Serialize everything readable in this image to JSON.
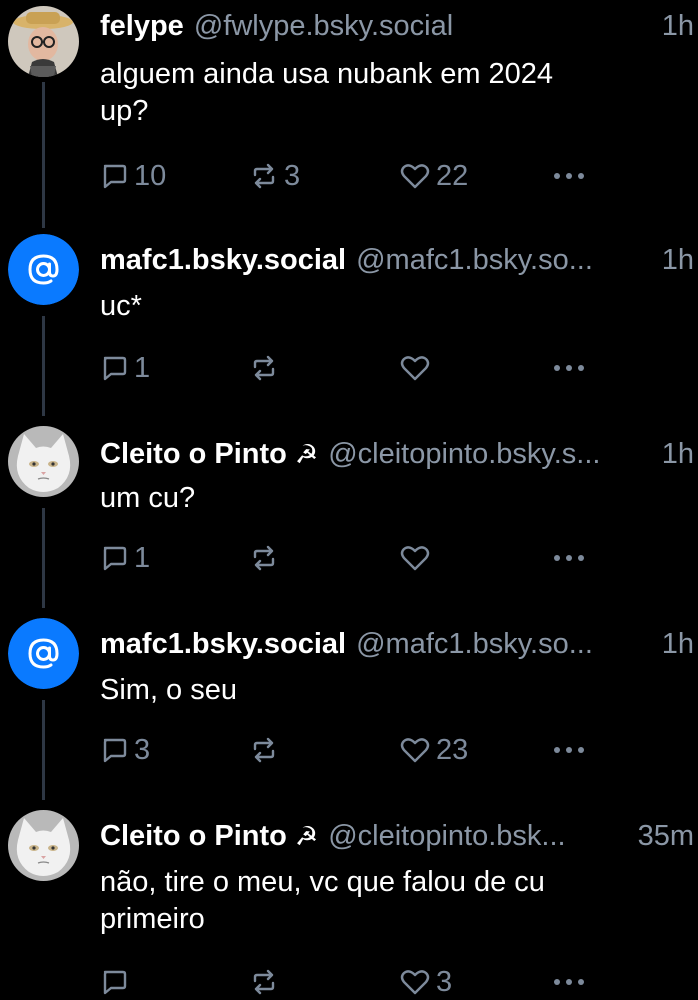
{
  "posts": [
    {
      "display_name": "felype",
      "handle": "@fwlype.bsky.social",
      "time": "1h",
      "text_lines": [
        "alguem ainda usa nubank em 2024",
        "up?"
      ],
      "replies": "10",
      "reposts": "3",
      "likes": "22",
      "avatar": "photo-person-hat"
    },
    {
      "display_name": "mafc1.bsky.social",
      "handle": "@mafc1.bsky.so...",
      "time": "1h",
      "text_lines": [
        "uc*"
      ],
      "replies": "1",
      "reposts": "",
      "likes": "",
      "avatar": "at-sign-default"
    },
    {
      "display_name": "Cleito o Pinto",
      "flag": "☭",
      "handle": "@cleitopinto.bsky.s...",
      "time": "1h",
      "text_lines": [
        "um cu?"
      ],
      "replies": "1",
      "reposts": "",
      "likes": "",
      "avatar": "photo-white-cat"
    },
    {
      "display_name": "mafc1.bsky.social",
      "handle": "@mafc1.bsky.so...",
      "time": "1h",
      "text_lines": [
        "Sim, o seu"
      ],
      "replies": "3",
      "reposts": "",
      "likes": "23",
      "avatar": "at-sign-default"
    },
    {
      "display_name": "Cleito o Pinto",
      "flag": "☭",
      "handle": "@cleitopinto.bsk...",
      "time": "35m",
      "text_lines": [
        "não, tire o meu, vc que falou de cu",
        "primeiro"
      ],
      "replies": "",
      "reposts": "",
      "likes": "3",
      "avatar": "photo-white-cat"
    }
  ],
  "colors": {
    "background": "#000000",
    "text": "#ffffff",
    "muted": "#8b97a6",
    "icon": "#7d8a9b",
    "thread_line": "#2e3744",
    "default_avatar": "#0a7aff"
  },
  "icons": [
    "reply-icon",
    "repost-icon",
    "like-icon",
    "more-icon"
  ]
}
